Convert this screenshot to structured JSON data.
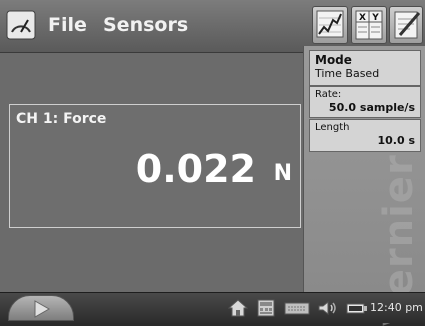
{
  "menu": {
    "file": "File",
    "sensors": "Sensors"
  },
  "toolbar": {
    "table_labels": [
      "X",
      "Y"
    ]
  },
  "meter": {
    "label": "CH 1: Force",
    "value": "0.022",
    "unit": "N"
  },
  "settings": {
    "mode_title": "Mode",
    "mode_value": "Time Based",
    "rate_label": "Rate:",
    "rate_value": "50.0 sample/s",
    "length_label": "Length",
    "length_value": "10.0 s"
  },
  "brand": "Vernier",
  "status": {
    "time": "12:40 pm"
  },
  "icons": [
    "gauge-icon",
    "graph-icon",
    "table-icon",
    "notes-icon",
    "play-icon",
    "home-icon",
    "esc-keyboard-icon",
    "keyboard-icon",
    "speaker-icon",
    "battery-icon"
  ]
}
